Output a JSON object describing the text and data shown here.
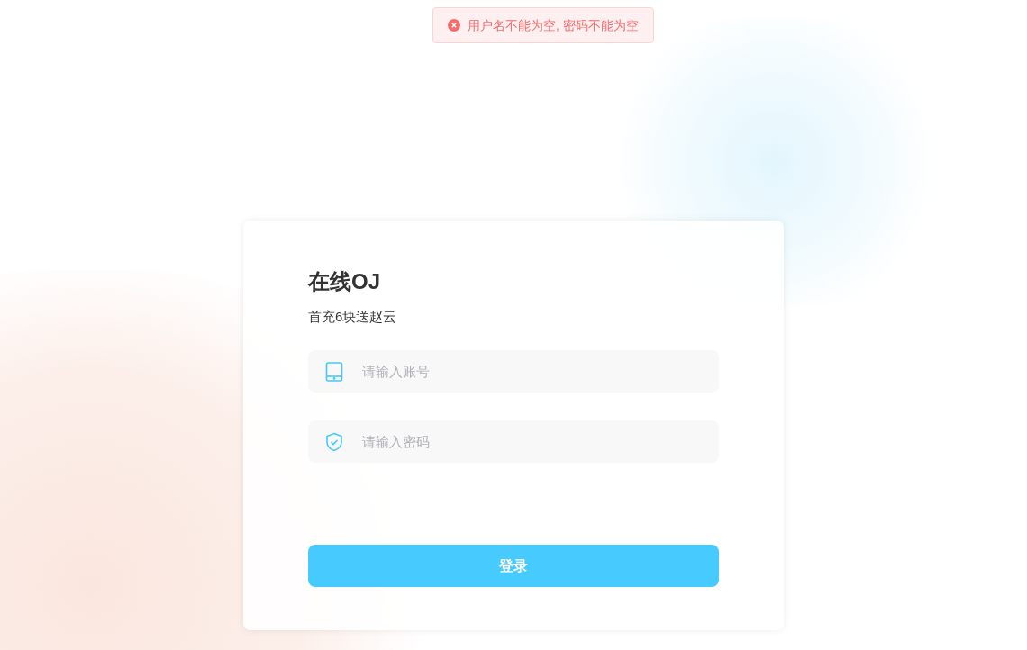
{
  "toast": {
    "kind": "error",
    "message": "用户名不能为空, 密码不能为空"
  },
  "login": {
    "title": "在线OJ",
    "subtitle": "首充6块送赵云",
    "fields": [
      {
        "kind": "account",
        "placeholder": "请输入账号"
      },
      {
        "kind": "password",
        "placeholder": "请输入密码"
      }
    ],
    "submit": "登录"
  }
}
